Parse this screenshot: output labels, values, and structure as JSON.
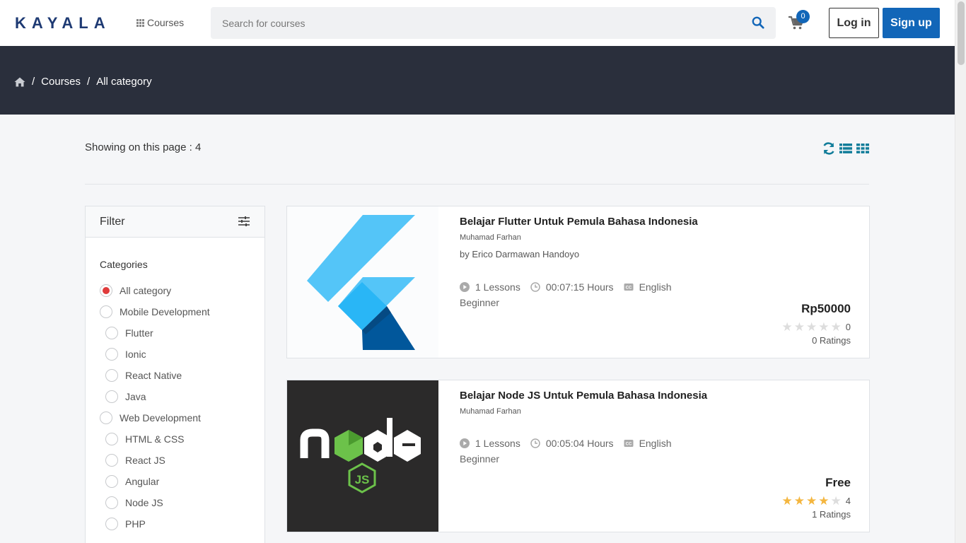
{
  "header": {
    "logo": "KAYALA",
    "courses_menu": "Courses",
    "search_placeholder": "Search for courses",
    "cart_count": "0",
    "login": "Log in",
    "signup": "Sign up"
  },
  "breadcrumb": {
    "items": [
      "Courses",
      "All category"
    ],
    "separator": "/"
  },
  "toolbar": {
    "showing": "Showing on this page : 4"
  },
  "filter": {
    "title": "Filter",
    "categories_title": "Categories",
    "categories": [
      {
        "label": "All category",
        "level": "top",
        "selected": true
      },
      {
        "label": "Mobile Development",
        "level": "top",
        "selected": false
      },
      {
        "label": "Flutter",
        "level": "sub",
        "selected": false
      },
      {
        "label": "Ionic",
        "level": "sub",
        "selected": false
      },
      {
        "label": "React Native",
        "level": "sub",
        "selected": false
      },
      {
        "label": "Java",
        "level": "sub",
        "selected": false
      },
      {
        "label": "Web Development",
        "level": "top",
        "selected": false
      },
      {
        "label": "HTML & CSS",
        "level": "sub",
        "selected": false
      },
      {
        "label": "React JS",
        "level": "sub",
        "selected": false
      },
      {
        "label": "Angular",
        "level": "sub",
        "selected": false
      },
      {
        "label": "Node JS",
        "level": "sub",
        "selected": false
      },
      {
        "label": "PHP",
        "level": "sub",
        "selected": false
      }
    ]
  },
  "courses": [
    {
      "title": "Belajar Flutter Untuk Pemula Bahasa Indonesia",
      "author": "Muhamad Farhan",
      "by": "by Erico Darmawan Handoyo",
      "lessons": "1 Lessons",
      "duration": "00:07:15 Hours",
      "language": "English",
      "level": "Beginner",
      "price": "Rp50000",
      "rating": 0,
      "rating_value": "0",
      "ratings_count": "0 Ratings",
      "image": "flutter-logo"
    },
    {
      "title": "Belajar Node JS Untuk Pemula Bahasa Indonesia",
      "author": "Muhamad Farhan",
      "by": "",
      "lessons": "1 Lessons",
      "duration": "00:05:04 Hours",
      "language": "English",
      "level": "Beginner",
      "price": "Free",
      "rating": 4,
      "rating_value": "4",
      "ratings_count": "1 Ratings",
      "image": "nodejs-logo"
    }
  ],
  "colors": {
    "brand": "#1266b8",
    "banner": "#2a2f3c",
    "radio_selected": "#e03b3b",
    "star": "#f4b63f"
  }
}
